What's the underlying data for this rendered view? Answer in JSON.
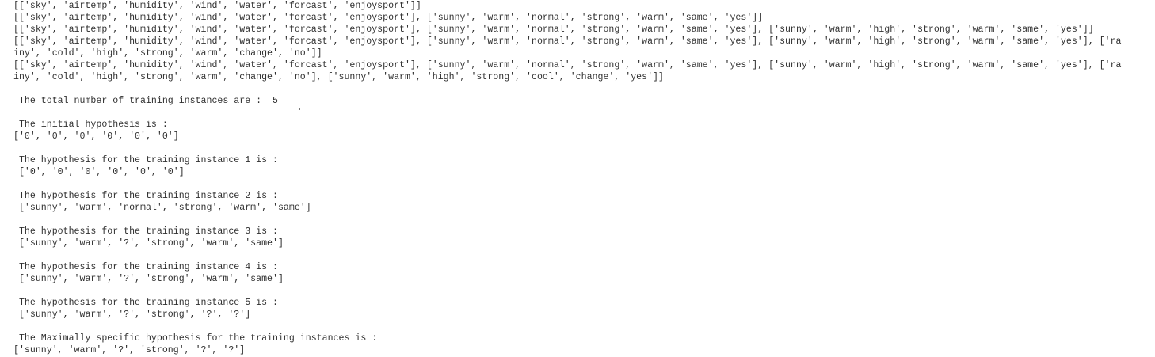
{
  "output": {
    "lines": [
      "[['sky', 'airtemp', 'humidity', 'wind', 'water', 'forcast', 'enjoysport']]",
      "[['sky', 'airtemp', 'humidity', 'wind', 'water', 'forcast', 'enjoysport'], ['sunny', 'warm', 'normal', 'strong', 'warm', 'same', 'yes']]",
      "[['sky', 'airtemp', 'humidity', 'wind', 'water', 'forcast', 'enjoysport'], ['sunny', 'warm', 'normal', 'strong', 'warm', 'same', 'yes'], ['sunny', 'warm', 'high', 'strong', 'warm', 'same', 'yes']]",
      "[['sky', 'airtemp', 'humidity', 'wind', 'water', 'forcast', 'enjoysport'], ['sunny', 'warm', 'normal', 'strong', 'warm', 'same', 'yes'], ['sunny', 'warm', 'high', 'strong', 'warm', 'same', 'yes'], ['ra",
      "iny', 'cold', 'high', 'strong', 'warm', 'change', 'no']]",
      "[['sky', 'airtemp', 'humidity', 'wind', 'water', 'forcast', 'enjoysport'], ['sunny', 'warm', 'normal', 'strong', 'warm', 'same', 'yes'], ['sunny', 'warm', 'high', 'strong', 'warm', 'same', 'yes'], ['ra",
      "iny', 'cold', 'high', 'strong', 'warm', 'change', 'no'], ['sunny', 'warm', 'high', 'strong', 'cool', 'change', 'yes']]",
      "",
      " The total number of training instances are :  5",
      "",
      " The initial hypothesis is : ",
      "['0', '0', '0', '0', '0', '0']",
      "",
      " The hypothesis for the training instance 1 is : ",
      " ['0', '0', '0', '0', '0', '0']",
      "",
      " The hypothesis for the training instance 2 is : ",
      " ['sunny', 'warm', 'normal', 'strong', 'warm', 'same']",
      "",
      " The hypothesis for the training instance 3 is : ",
      " ['sunny', 'warm', '?', 'strong', 'warm', 'same']",
      "",
      " The hypothesis for the training instance 4 is : ",
      " ['sunny', 'warm', '?', 'strong', 'warm', 'same']",
      "",
      " The hypothesis for the training instance 5 is : ",
      " ['sunny', 'warm', '?', 'strong', '?', '?']",
      "",
      " The Maximally specific hypothesis for the training instances is : ",
      "['sunny', 'warm', '?', 'strong', '?', '?']"
    ]
  }
}
